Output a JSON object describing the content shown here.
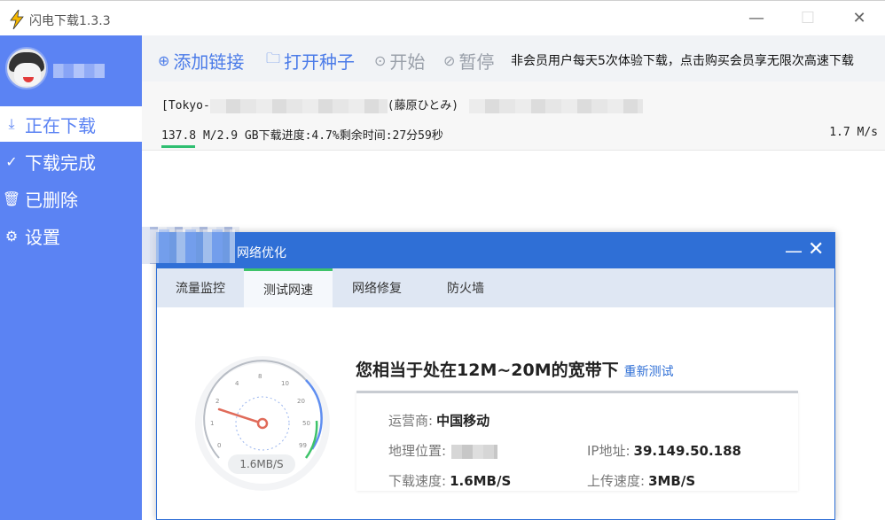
{
  "window": {
    "title": "闪电下载1.3.3",
    "minimize_label": "—",
    "maximize_label": "☐",
    "close_label": "✕"
  },
  "sidebar": {
    "items": [
      {
        "label": "正在下载",
        "icon": "download-icon",
        "glyph": "⤓"
      },
      {
        "label": "下载完成",
        "icon": "check-circle-icon",
        "glyph": "✓"
      },
      {
        "label": "已删除",
        "icon": "trash-icon",
        "glyph": "🗑"
      },
      {
        "label": "设置",
        "icon": "gear-icon",
        "glyph": "⚙"
      }
    ]
  },
  "toolbar": {
    "add_icon": "⊕",
    "add_label": "添加链接",
    "open_icon": "🗀",
    "open_label": "打开种子",
    "start_icon": "⊙",
    "start_label": "开始",
    "pause_icon": "⊘",
    "pause_label": "暂停",
    "notice": "非会员用户每天5次体验下载，点击购买会员享无限次高速下载"
  },
  "download": {
    "name_prefix": "[Tokyo-",
    "name_middle": "(藤原ひとみ)",
    "info": "137.8 M/2.9 GB下载进度:4.7%剩余时间:27分59秒",
    "speed": "1.7 M/s",
    "progress_percent": 4.7
  },
  "dialog": {
    "title": "网络优化",
    "minimize_label": "—",
    "close_label": "✕",
    "tabs": [
      "流量监控",
      "测试网速",
      "网络修复",
      "防火墙"
    ],
    "active_tab": 1,
    "result_text": "您相当于处在12M~20M的宽带下",
    "retest_label": "重新测试",
    "gauge_value": "1.6MB/S",
    "gauge_ticks": [
      "0",
      "1",
      "2",
      "4",
      "8",
      "10",
      "20",
      "50",
      "99"
    ],
    "fields": {
      "isp_label": "运营商:",
      "isp_value": "中国移动",
      "location_label": "地理位置:",
      "ip_label": "IP地址:",
      "ip_value": "39.149.50.188",
      "down_label": "下载速度:",
      "down_value": "1.6MB/S",
      "up_label": "上传速度:",
      "up_value": "3MB/S"
    }
  },
  "colors": {
    "sidebar_blue": "#5b83f3",
    "dialog_blue": "#2f6fd6",
    "progress_green": "#2fbf71"
  }
}
